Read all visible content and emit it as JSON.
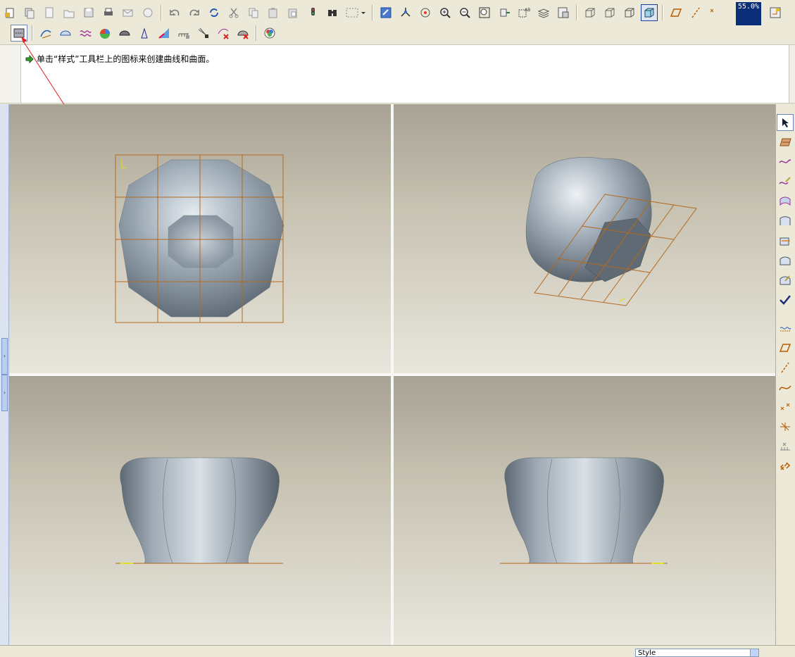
{
  "toolbar": {
    "zoom_readout": "55.0%"
  },
  "message": {
    "text": "单击“样式”工具栏上的图标来创建曲线和曲面。"
  },
  "viewports": [
    {
      "view": "top"
    },
    {
      "view": "isometric"
    },
    {
      "view": "front"
    },
    {
      "view": "side"
    }
  ],
  "statusbar": {
    "style_select_value": "Style"
  },
  "colors": {
    "model_steel": "#9aa7b3",
    "grid_orange": "#b4691e",
    "annotation_arrow": "#e41e1e",
    "zoom_bg": "#0a2d78"
  }
}
